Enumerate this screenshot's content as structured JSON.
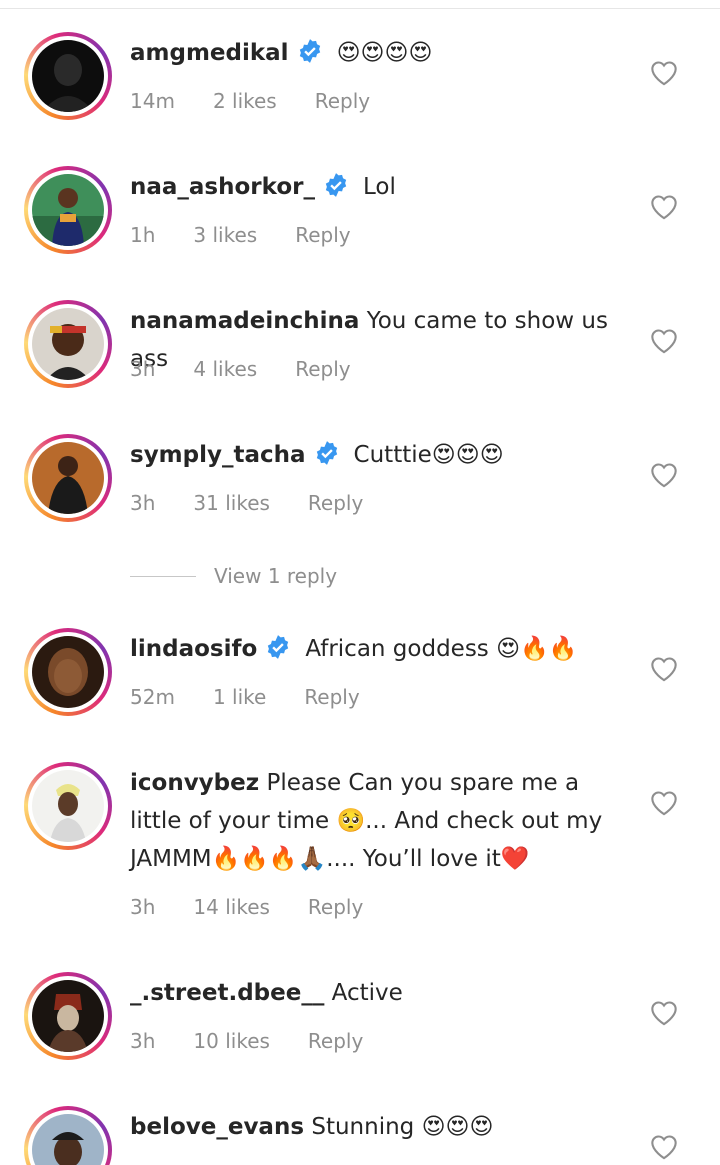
{
  "comments": [
    {
      "username": "amgmedikal",
      "verified": true,
      "text": "😍😍😍😍",
      "time": "14m",
      "likes": "2 likes",
      "reply": "Reply"
    },
    {
      "username": "naa_ashorkor_",
      "verified": true,
      "text": "Lol",
      "time": "1h",
      "likes": "3 likes",
      "reply": "Reply"
    },
    {
      "username": "nanamadeinchina",
      "verified": false,
      "text": "You came to show us ass",
      "time": "3h",
      "likes": "4 likes",
      "reply": "Reply"
    },
    {
      "username": "symply_tacha",
      "verified": true,
      "text": "Cutttie😍😍😍",
      "time": "3h",
      "likes": "31 likes",
      "reply": "Reply"
    },
    {
      "username": "lindaosifo",
      "verified": true,
      "text": "African goddess 😍🔥🔥",
      "time": "52m",
      "likes": "1 like",
      "reply": "Reply"
    },
    {
      "username": "iconvybez",
      "verified": false,
      "text": "Please Can you spare me a little of your time 🥺... And check out my JAMMM🔥🔥🔥🙏🏾.... You’ll love it❤️",
      "time": "3h",
      "likes": "14 likes",
      "reply": "Reply"
    },
    {
      "username": "_.street.dbee__",
      "verified": false,
      "text": "Active",
      "time": "3h",
      "likes": "10 likes",
      "reply": "Reply"
    },
    {
      "username": "belove_evans",
      "verified": false,
      "text": "Stunning 😍😍😍",
      "time": "",
      "likes": "",
      "reply": ""
    }
  ],
  "view_replies": "View 1 reply",
  "colors": {
    "verified": "#3897f0",
    "meta": "#8e8e8e",
    "text": "#262626"
  }
}
